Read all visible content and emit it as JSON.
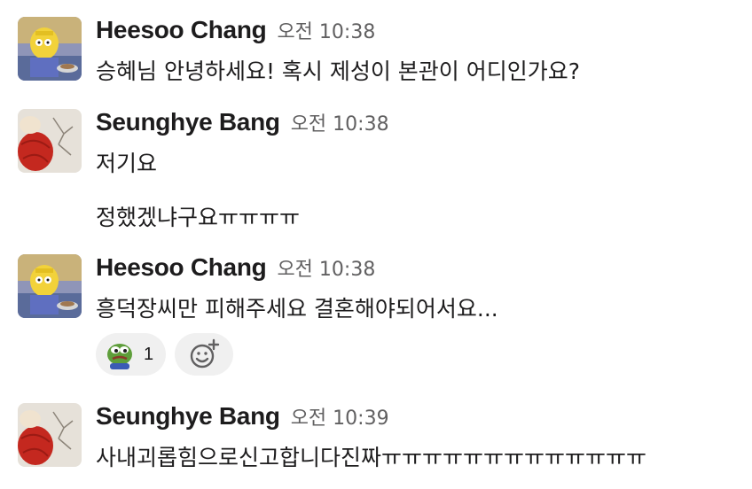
{
  "messages": [
    {
      "author": "Heesoo Chang",
      "time": "오전 10:38",
      "lines": [
        "승혜님 안녕하세요! 혹시 제성이 본관이 어디인가요?"
      ]
    },
    {
      "author": "Seunghye Bang",
      "time": "오전 10:38",
      "lines": [
        "저기요",
        "정했겠냐구요ㅠㅠㅠㅠ"
      ]
    },
    {
      "author": "Heesoo Chang",
      "time": "오전 10:38",
      "lines": [
        "흥덕장씨만 피해주세요 결혼해야되어서요..."
      ],
      "reactions": [
        {
          "emoji": "pepe-frog",
          "count": "1"
        }
      ]
    },
    {
      "author": "Seunghye Bang",
      "time": "오전 10:39",
      "lines": [
        "사내괴롭힘으로신고합니다진짜ㅠㅠㅠㅠㅠㅠㅠㅠㅠㅠㅠㅠㅠ"
      ]
    }
  ],
  "icons": {
    "add_reaction": "add-reaction-icon",
    "avatar_heesoo": "cartoon-kid-avatar",
    "avatar_seunghye": "red-yarn-avatar"
  },
  "colors": {
    "name": "#1d1c1d",
    "timestamp": "#616061",
    "reaction_bg": "#f0f0f0"
  }
}
